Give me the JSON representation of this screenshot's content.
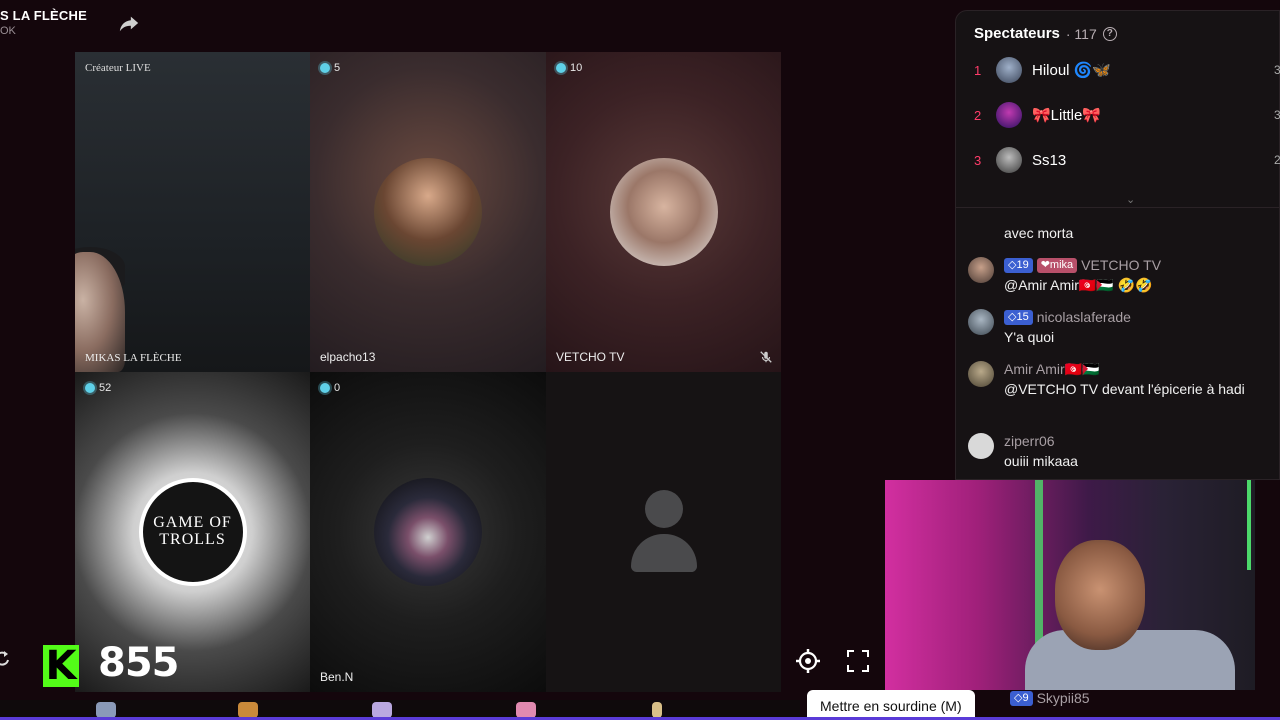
{
  "header": {
    "title": "S LA FLÈCHE",
    "subtitle": "OK"
  },
  "tiles": [
    {
      "creator_label": "Créateur LIVE",
      "name": "MIKAS LA FLÈCHE"
    },
    {
      "badge": "5",
      "name": "elpacho13"
    },
    {
      "badge": "10",
      "name": "VETCHO TV"
    },
    {
      "badge": "52",
      "name": "",
      "logo_line1": "GAME OF",
      "logo_line2": "TROLLS"
    },
    {
      "badge": "0",
      "name": "Ben.N"
    },
    {
      "badge": "",
      "name": ""
    }
  ],
  "viewers": {
    "title": "Spectateurs",
    "count": "· 117",
    "help": "?",
    "list": [
      {
        "rank": "1",
        "name": "Hiloul 🌀🦋",
        "edge": "3"
      },
      {
        "rank": "2",
        "name": "🎀Little🎀",
        "edge": "3"
      },
      {
        "rank": "3",
        "name": "Ss13",
        "edge": "2"
      }
    ]
  },
  "chat": {
    "partial_msg": "avec morta",
    "messages": [
      {
        "level": "19",
        "fan": "❤mika",
        "user": "VETCHO TV",
        "msg": "@Amir Amir🇹🇳🇵🇸 🤣🤣"
      },
      {
        "level": "15",
        "fan": "",
        "user": "nicolaslaferade",
        "msg": "Y'a quoi"
      },
      {
        "level": "",
        "fan": "",
        "user": "Amir Amir🇹🇳🇵🇸",
        "msg": "@VETCHO TV devant l'épicerie à hadi"
      },
      {
        "level": "",
        "fan": "",
        "user": "ziperr06",
        "msg": "ouiii mikaaa"
      }
    ],
    "bottom": {
      "level": "9",
      "user": "Skypii85"
    }
  },
  "kick": {
    "logo": "K",
    "count": "855"
  },
  "tooltip": "Mettre en sourdine (M)",
  "colors": {
    "accent_kick": "#53fc18",
    "rank": "#ff3c6a",
    "level": "#3b5fd1",
    "live_dot": "#5fd0e8"
  }
}
